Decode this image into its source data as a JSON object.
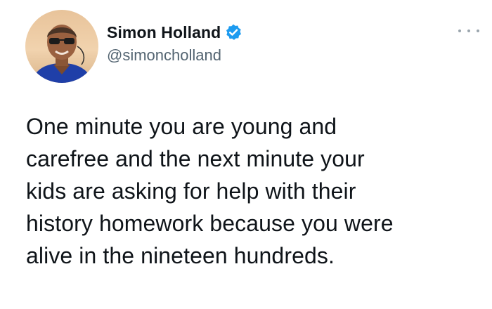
{
  "author": {
    "name": "Simon Holland",
    "handle": "@simoncholland",
    "verified": true,
    "badge_color": "#1d9bf0"
  },
  "tweet": {
    "text": "One minute you are young and\ncarefree and the next minute your\nkids are asking for help with their\nhistory homework because you were\nalive in the nineteen hundreds."
  },
  "icons": {
    "more": "more-options-icon",
    "verified": "verified-badge-icon",
    "avatar": "profile-photo"
  },
  "colors": {
    "text": "#0f1419",
    "secondary": "#536471",
    "accent": "#1d9bf0",
    "background": "#ffffff"
  }
}
